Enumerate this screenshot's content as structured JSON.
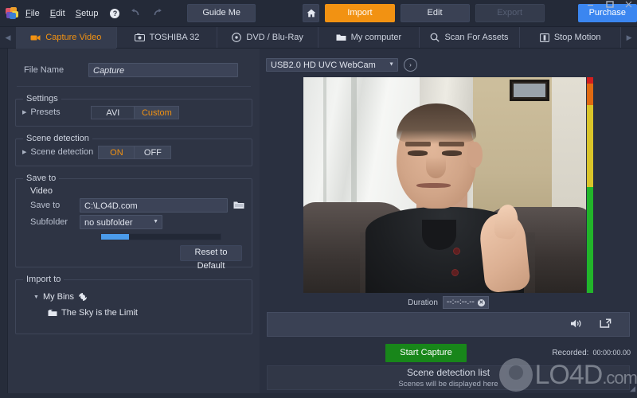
{
  "window": {
    "controls": {
      "minimize": "–",
      "maximize": "❐",
      "close": "✕"
    }
  },
  "menubar": {
    "logo": "pinnacle-logo-icon",
    "items": [
      {
        "label": "File",
        "mnemonic": "F"
      },
      {
        "label": "Edit",
        "mnemonic": "E"
      },
      {
        "label": "Setup",
        "mnemonic": "S"
      }
    ],
    "help_icon": "?",
    "undo_icon": "←",
    "redo_icon": "→",
    "guide_me": "Guide Me",
    "home_icon": "home-icon",
    "import": "Import",
    "edit": "Edit",
    "export": "Export",
    "purchase": "Purchase"
  },
  "tabs": {
    "scroll_left": "◀",
    "scroll_right": "▶",
    "items": [
      {
        "label": "Capture Video",
        "icon": "video-camera-icon",
        "active": true
      },
      {
        "label": "TOSHIBA 32",
        "icon": "camera-icon",
        "active": false
      },
      {
        "label": "DVD / Blu-Ray",
        "icon": "disc-icon",
        "active": false
      },
      {
        "label": "My computer",
        "icon": "folder-icon",
        "active": false
      },
      {
        "label": "Scan For Assets",
        "icon": "search-icon",
        "active": false
      },
      {
        "label": "Stop Motion",
        "icon": "stop-motion-icon",
        "active": false
      }
    ]
  },
  "left_panel": {
    "file_name_label": "File Name",
    "file_name_value": "Capture",
    "settings": {
      "legend": "Settings",
      "presets_label": "Presets",
      "options": [
        {
          "label": "AVI",
          "selected": false
        },
        {
          "label": "Custom",
          "selected": true
        }
      ]
    },
    "scene_detection": {
      "legend": "Scene detection",
      "label": "Scene detection",
      "options": [
        {
          "label": "ON",
          "selected": true
        },
        {
          "label": "OFF",
          "selected": false
        }
      ]
    },
    "save_to": {
      "legend": "Save to",
      "subhead": "Video",
      "path_label": "Save to",
      "path_value": "C:\\LO4D.com",
      "browse_icon": "folder-browse-icon",
      "subfolder_label": "Subfolder",
      "subfolder_value": "no subfolder",
      "disk_usage_percent": 23,
      "reset_label": "Reset to Default"
    },
    "import_to": {
      "legend": "Import to",
      "root_label": "My Bins",
      "root_icon": "bins-refresh-icon",
      "children": [
        {
          "label": "The Sky is the Limit",
          "icon": "bin-icon"
        }
      ]
    }
  },
  "right_panel": {
    "device_value": "USB2.0 HD UVC WebCam",
    "device_go_icon": "›",
    "preview_alt": "live webcam preview of a man on a couch giving a thumbs up",
    "vu_meter": {
      "name": "audio-level-meter",
      "segments": [
        {
          "color": "#d21f1f",
          "height_pct": 3
        },
        {
          "color": "#e06a12",
          "height_pct": 10
        },
        {
          "color": "#d9c42a",
          "height_pct": 38
        },
        {
          "color": "#22b52a",
          "height_pct": 49
        }
      ]
    },
    "duration_label": "Duration",
    "duration_value": "--:--:--.--",
    "duration_clear_icon": "✕",
    "volume_icon": "speaker-icon",
    "fullscreen_icon": "fullscreen-icon",
    "start_capture": "Start Capture",
    "recorded_label": "Recorded:",
    "recorded_value": "00:00:00.00",
    "scene_list": {
      "title": "Scene detection list",
      "subtitle": "Scenes will be displayed here"
    },
    "watermark": {
      "text": "LO4D",
      "suffix": ".com"
    }
  }
}
